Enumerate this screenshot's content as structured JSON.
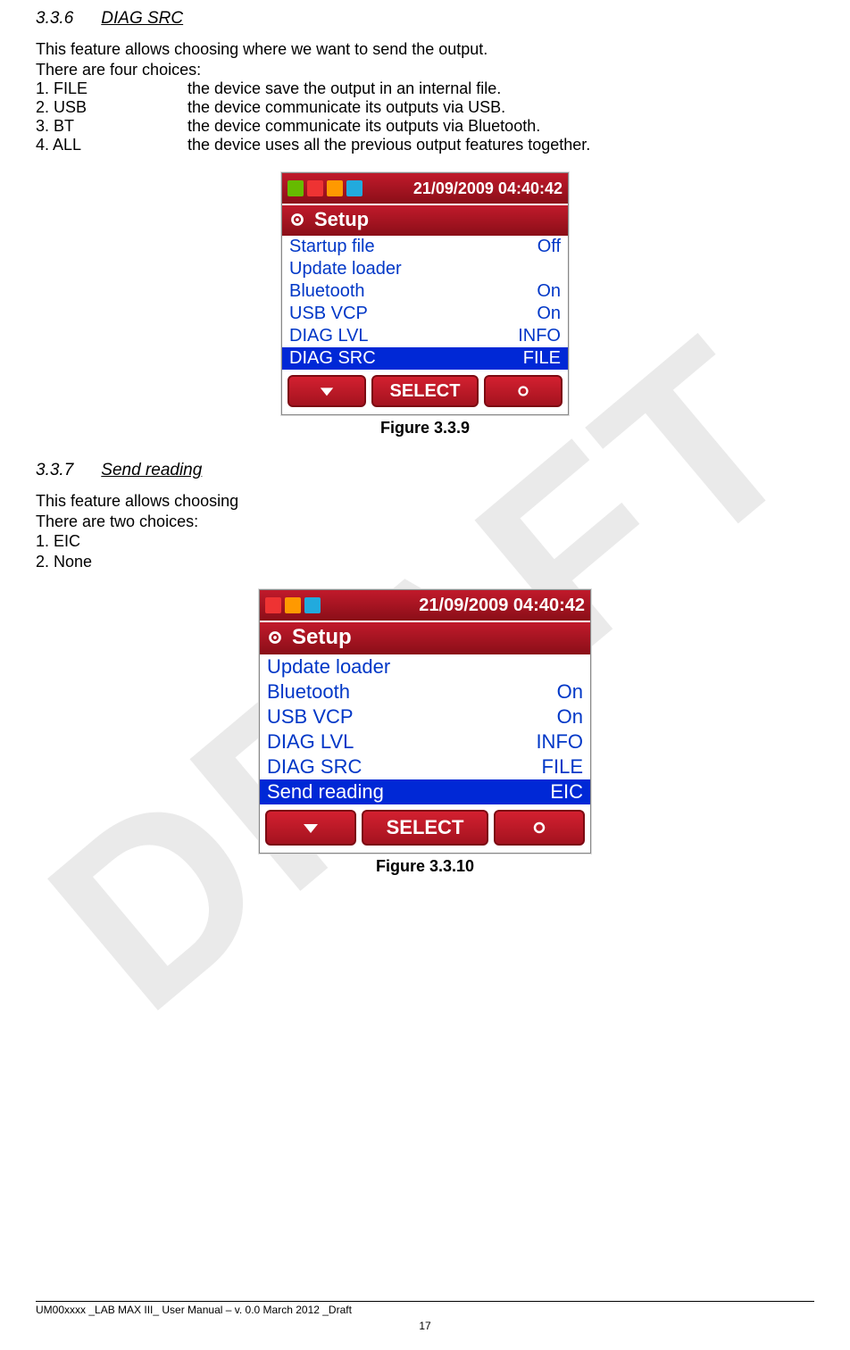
{
  "watermark": "DRAFT",
  "section1": {
    "num": "3.3.6",
    "title": "DIAG SRC",
    "intro1": "This feature allows choosing where we want to send the output.",
    "intro2": "There are four choices:",
    "items": [
      {
        "key": "1.  FILE",
        "desc": "the device save the output in an internal file."
      },
      {
        "key": "2.  USB",
        "desc": "the device communicate its outputs via USB."
      },
      {
        "key": "3.  BT",
        "desc": "the device communicate its outputs via Bluetooth."
      },
      {
        "key": "4.  ALL",
        "desc": "the device uses all the previous output features together."
      }
    ]
  },
  "device1": {
    "clock": "21/09/2009 04:40:42",
    "setup": "Setup",
    "rows": [
      {
        "label": "Startup file",
        "value": "Off",
        "sel": false
      },
      {
        "label": "Update loader",
        "value": "",
        "sel": false
      },
      {
        "label": "Bluetooth",
        "value": "On",
        "sel": false
      },
      {
        "label": "USB VCP",
        "value": "On",
        "sel": false
      },
      {
        "label": "DIAG LVL",
        "value": "INFO",
        "sel": false
      },
      {
        "label": "DIAG SRC",
        "value": "FILE",
        "sel": true
      }
    ],
    "softkey_center": "SELECT",
    "caption": "Figure 3.3.9"
  },
  "section2": {
    "num": "3.3.7",
    "title": "Send reading",
    "intro1": "This feature allows choosing",
    "intro2": "There are two choices:",
    "items": [
      {
        "key": "1.  EIC"
      },
      {
        "key": "2.  None"
      }
    ]
  },
  "device2": {
    "clock": "21/09/2009 04:40:42",
    "setup": "Setup",
    "rows": [
      {
        "label": "Update loader",
        "value": "",
        "sel": false
      },
      {
        "label": "Bluetooth",
        "value": "On",
        "sel": false
      },
      {
        "label": "USB VCP",
        "value": "On",
        "sel": false
      },
      {
        "label": "DIAG LVL",
        "value": "INFO",
        "sel": false
      },
      {
        "label": "DIAG SRC",
        "value": "FILE",
        "sel": false
      },
      {
        "label": "Send reading",
        "value": "EIC",
        "sel": true
      }
    ],
    "softkey_center": "SELECT",
    "caption": "Figure 3.3.10"
  },
  "footer": {
    "left": "UM00xxxx _LAB MAX III_ User Manual – v. 0.0 March 2012 _Draft",
    "page": "17"
  }
}
